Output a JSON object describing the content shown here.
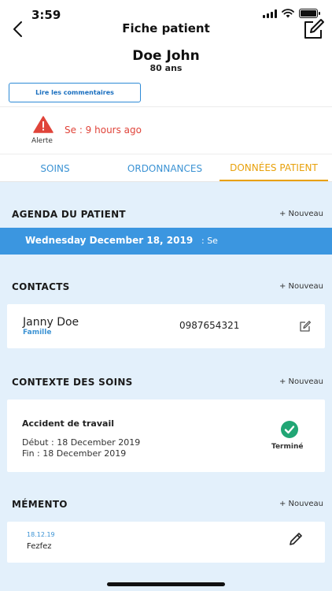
{
  "status_bar": {
    "time": "3:59"
  },
  "nav": {
    "title": "Fiche patient",
    "back_icon": "chevron-left-icon",
    "edit_icon": "edit-square-icon"
  },
  "patient": {
    "name": "Doe John",
    "age": "80 ans"
  },
  "comments_button": {
    "label": "Lire les commentaires"
  },
  "alert": {
    "label": "Alerte",
    "text": "Se : 9 hours ago",
    "icon": "warning-triangle-icon",
    "color": "#e0443a"
  },
  "tabs": [
    {
      "label": "SOINS",
      "active": false
    },
    {
      "label": "ORDONNANCES",
      "active": false
    },
    {
      "label": "DONNÉES PATIENT",
      "active": true
    }
  ],
  "colors": {
    "accent": "#3b96e0",
    "active_tab": "#e8a10c",
    "content_bg": "#e3f0fb",
    "check": "#21a675"
  },
  "agenda": {
    "title": "AGENDA DU PATIENT",
    "add_label": "+ Nouveau",
    "date": "Wednesday December 18, 2019",
    "suffix": ": Se"
  },
  "contacts": {
    "title": "CONTACTS",
    "add_label": "+ Nouveau",
    "items": [
      {
        "name": "Janny Doe",
        "relation": "Famille",
        "phone": "0987654321"
      }
    ]
  },
  "context": {
    "title": "CONTEXTE DES SOINS",
    "add_label": "+ Nouveau",
    "items": [
      {
        "title": "Accident de travail",
        "start": "Début : 18 December 2019",
        "end": "Fin : 18 December 2019",
        "status": "Terminé"
      }
    ]
  },
  "memento": {
    "title": "MÉMENTO",
    "add_label": "+ Nouveau",
    "items": [
      {
        "date": "18.12.19",
        "text": "Fezfez"
      }
    ]
  }
}
